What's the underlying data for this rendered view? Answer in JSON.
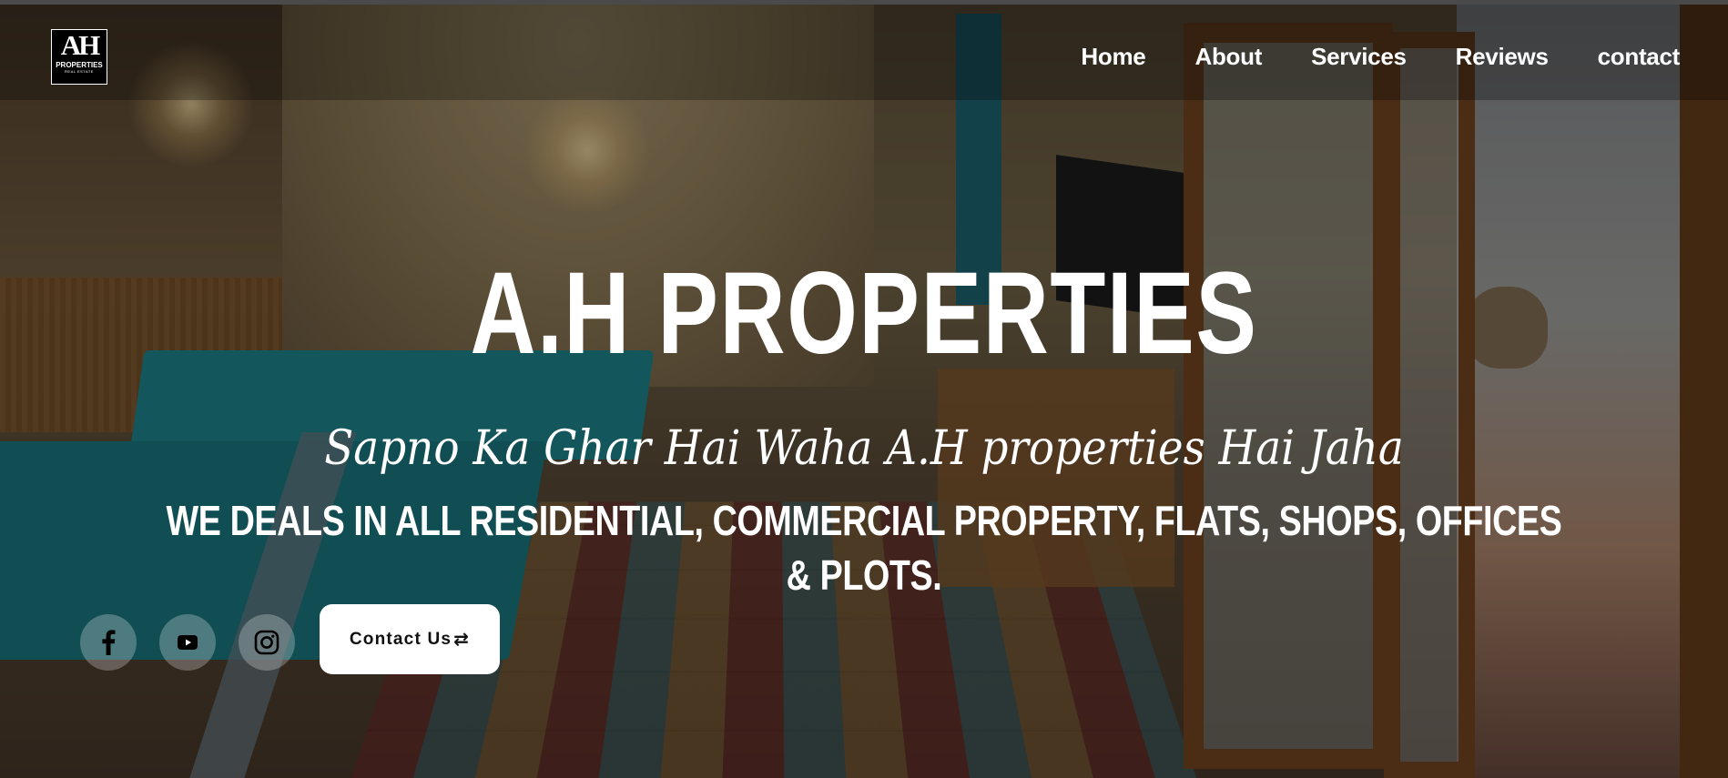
{
  "logo": {
    "mark": "AH",
    "name": "PROPERTIES",
    "sub": "REAL ESTATE"
  },
  "nav": [
    {
      "label": "Home"
    },
    {
      "label": "About"
    },
    {
      "label": "Services"
    },
    {
      "label": "Reviews"
    },
    {
      "label": "contact"
    }
  ],
  "hero": {
    "title": "A.H PROPERTIES",
    "tagline": "Sapno Ka Ghar Hai Waha A.H properties Hai Jaha",
    "subtitle": "WE DEALS IN ALL RESIDENTIAL, COMMERCIAL PROPERTY, FLATS, SHOPS, OFFICES & PLOTS."
  },
  "social": [
    {
      "icon": "facebook-icon"
    },
    {
      "icon": "youtube-icon"
    },
    {
      "icon": "instagram-icon"
    }
  ],
  "cta": {
    "label": "Contact Us",
    "icon": "⇄"
  },
  "colors": {
    "text": "#ffffff",
    "cta_bg": "#ffffff",
    "cta_text": "#111111"
  }
}
